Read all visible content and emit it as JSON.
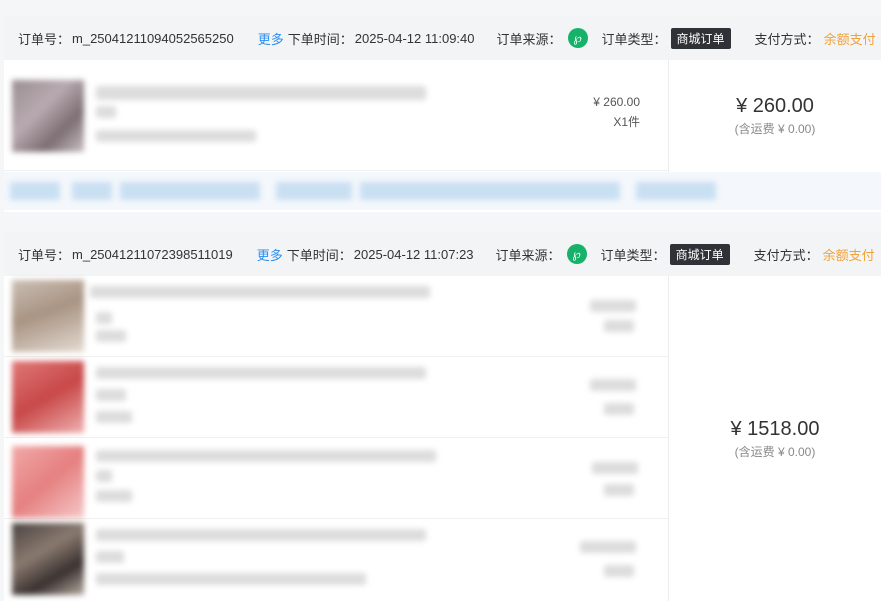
{
  "labels": {
    "order_no": "订单号：",
    "more": "更多",
    "order_time": "下单时间：",
    "source": "订单来源：",
    "order_type": "订单类型：",
    "payment": "支付方式："
  },
  "icons": {
    "source_icon": "mini-program-icon"
  },
  "colors": {
    "link": "#2a8ef0",
    "source_icon_bg": "#17b26a",
    "badge_bg": "#2f3237",
    "payment": "#f0a23a"
  },
  "orders": [
    {
      "order_no": "m_25041211094052565250",
      "order_time": "2025-04-12 11:09:40",
      "type": "商城订单",
      "payment": "余额支付",
      "total": "¥ 260.00",
      "freight": "(含运费 ¥ 0.00)",
      "items": [
        {
          "price": "¥ 260.00",
          "qty": "X1件"
        }
      ]
    },
    {
      "order_no": "m_25041211072398511019",
      "order_time": "2025-04-12 11:07:23",
      "type": "商城订单",
      "payment": "余额支付",
      "total": "¥ 1518.00",
      "freight": "(含运费 ¥ 0.00)"
    }
  ]
}
